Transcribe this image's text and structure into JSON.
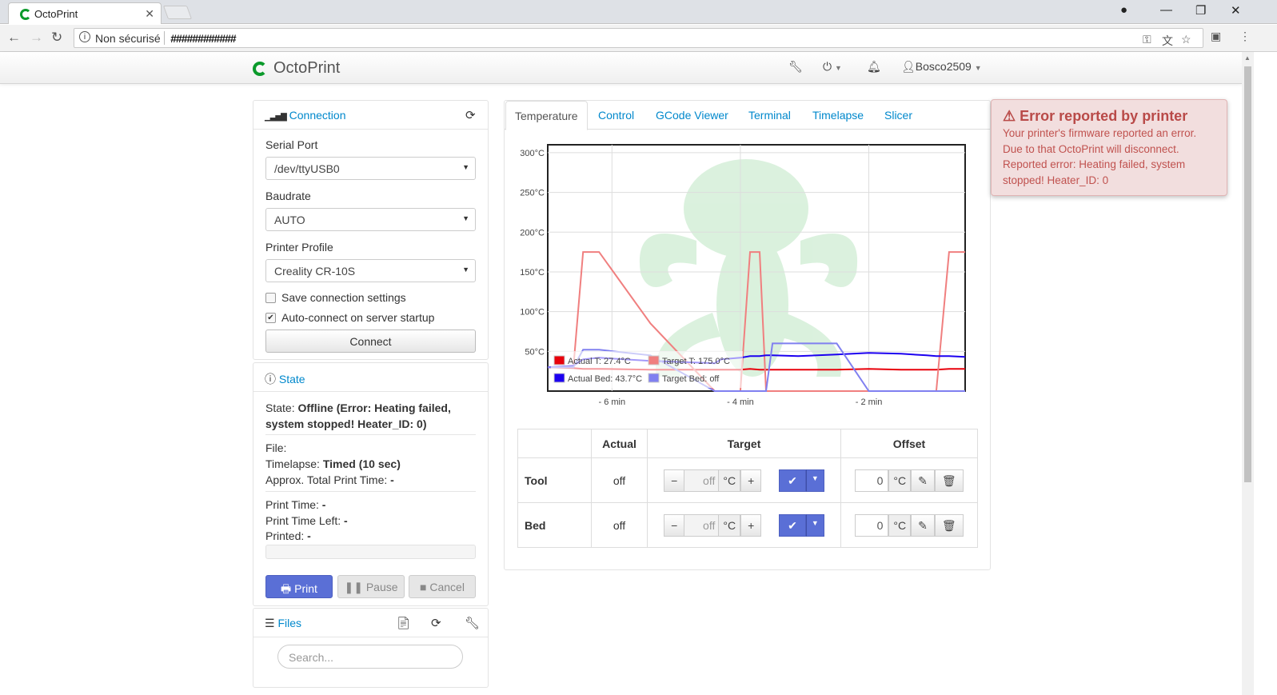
{
  "browser": {
    "tab_title": "OctoPrint",
    "tab_close": "✕",
    "security_label": "Non sécurisé",
    "url": "############"
  },
  "navbar": {
    "brand": "OctoPrint",
    "user": "Bosco2509"
  },
  "connection": {
    "title": "Connection",
    "serial_port_label": "Serial Port",
    "serial_port_value": "/dev/ttyUSB0",
    "baudrate_label": "Baudrate",
    "baudrate_value": "AUTO",
    "profile_label": "Printer Profile",
    "profile_value": "Creality CR-10S",
    "save_settings_label": "Save connection settings",
    "save_settings_checked": false,
    "autoconnect_label": "Auto-connect on server startup",
    "autoconnect_checked": true,
    "connect_button": "Connect"
  },
  "state": {
    "title": "State",
    "state_label": "State:",
    "state_value": "Offline (Error: Heating failed, system stopped! Heater_ID: 0)",
    "file_label": "File:",
    "timelapse_label": "Timelapse:",
    "timelapse_value": "Timed (10 sec)",
    "approx_label": "Approx. Total Print Time:",
    "approx_value": "-",
    "print_time_label": "Print Time:",
    "print_time_value": "-",
    "time_left_label": "Print Time Left:",
    "time_left_value": "-",
    "printed_label": "Printed:",
    "printed_value": "-",
    "progress": 0,
    "print_button": "Print",
    "pause_button": "Pause",
    "cancel_button": "Cancel"
  },
  "files": {
    "title": "Files",
    "search_placeholder": "Search..."
  },
  "tabs": [
    "Temperature",
    "Control",
    "GCode Viewer",
    "Terminal",
    "Timelapse",
    "Slicer"
  ],
  "chart_data": {
    "type": "line",
    "title": "",
    "xlabel": "",
    "ylabel": "",
    "x_ticks": [
      "- 6 min",
      "- 4 min",
      "- 2 min"
    ],
    "y_ticks": [
      "50°C",
      "100°C",
      "150°C",
      "200°C",
      "250°C",
      "300°C"
    ],
    "xlim": [
      -7,
      -0.5
    ],
    "ylim": [
      0,
      310
    ],
    "x": [
      -7,
      -6.6,
      -6.45,
      -6.2,
      -5.4,
      -4.4,
      -4.3,
      -4.0,
      -3.85,
      -3.7,
      -3.6,
      -3.5,
      -3.1,
      -2.5,
      -2.0,
      -1.5,
      -1.1,
      -0.95,
      -0.75,
      -0.5
    ],
    "series": [
      {
        "name": "Actual T: 27.4°C",
        "color": "#e8000b",
        "values": [
          30,
          29,
          28,
          28,
          27,
          27,
          27,
          27,
          28,
          27,
          27,
          27,
          27,
          27,
          28,
          27,
          27,
          27,
          28,
          28
        ]
      },
      {
        "name": "Target T: 175.0°C",
        "color": "#f07f7f",
        "values": [
          30,
          30,
          175,
          175,
          85,
          0,
          0,
          0,
          175,
          175,
          0,
          0,
          0,
          0,
          0,
          0,
          0,
          0,
          175,
          175
        ]
      },
      {
        "name": "Actual Bed: 43.7°C",
        "color": "#1c00f0",
        "values": [
          30,
          32,
          40,
          42,
          38,
          35,
          40,
          42,
          44,
          44,
          45,
          45,
          44,
          46,
          48,
          47,
          45,
          44,
          44,
          43
        ]
      },
      {
        "name": "Target Bed: off",
        "color": "#8080f0",
        "values": [
          30,
          30,
          52,
          52,
          45,
          0,
          0,
          0,
          0,
          0,
          0,
          60,
          60,
          60,
          0,
          0,
          0,
          0,
          0,
          0
        ]
      }
    ],
    "legend": [
      {
        "label": "Actual T: 27.4°C",
        "color": "#e8000b"
      },
      {
        "label": "Target T: 175.0°C",
        "color": "#f07f7f"
      },
      {
        "label": "Actual Bed: 43.7°C",
        "color": "#1c00f0"
      },
      {
        "label": "Target Bed: off",
        "color": "#8080f0"
      }
    ],
    "legend_position": "bottom-left",
    "grid": true
  },
  "temp_table": {
    "col_actual": "Actual",
    "col_target": "Target",
    "col_offset": "Offset",
    "rows": [
      {
        "name": "Tool",
        "actual": "off",
        "target_placeholder": "off",
        "unit": "°C",
        "offset": "0"
      },
      {
        "name": "Bed",
        "actual": "off",
        "target_placeholder": "off",
        "unit": "°C",
        "offset": "0"
      }
    ],
    "minus": "−",
    "plus": "+"
  },
  "error": {
    "title": "Error reported by printer",
    "message": "Your printer's firmware reported an error. Due to that OctoPrint will disconnect. Reported error: Heating failed, system stopped! Heater_ID: 0",
    "color": "#b94a48"
  }
}
